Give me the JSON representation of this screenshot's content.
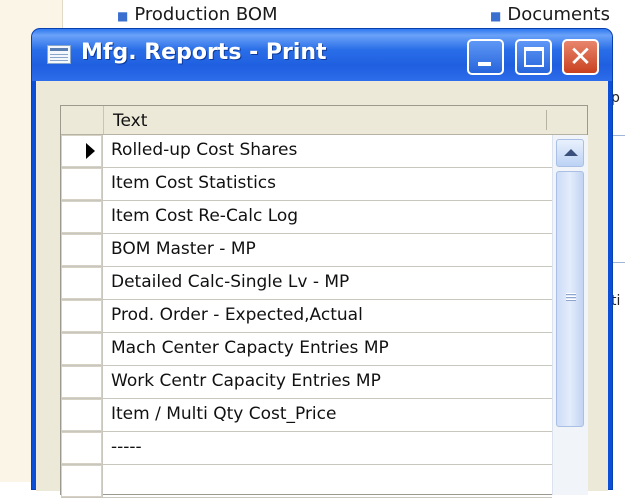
{
  "background": {
    "links": [
      "Production BOM",
      "Documents"
    ],
    "right_fragments": [
      "p",
      "ti"
    ]
  },
  "window": {
    "title": "Mfg. Reports - Print",
    "buttons": {
      "minimize": "minimize",
      "maximize": "maximize",
      "close": "close"
    }
  },
  "grid": {
    "column_header": "Text",
    "rows": [
      "Rolled-up Cost Shares",
      "Item Cost Statistics",
      "Item Cost Re-Calc Log",
      "BOM Master - MP",
      "Detailed Calc-Single Lv - MP",
      "Prod. Order - Expected,Actual",
      "Mach Center Capacty Entries MP",
      "Work Centr Capacity Entries MP",
      "Item / Multi Qty Cost_Price",
      "-----",
      ""
    ],
    "current_row_index": 0
  },
  "colors": {
    "titlebar": "#2a6ee8",
    "close_button": "#d9573a",
    "client_background": "#ece9d8"
  },
  "icons": [
    "app-window-icon",
    "current-row-pointer-icon",
    "scroll-up-arrow-icon",
    "scroll-grip-icon"
  ]
}
